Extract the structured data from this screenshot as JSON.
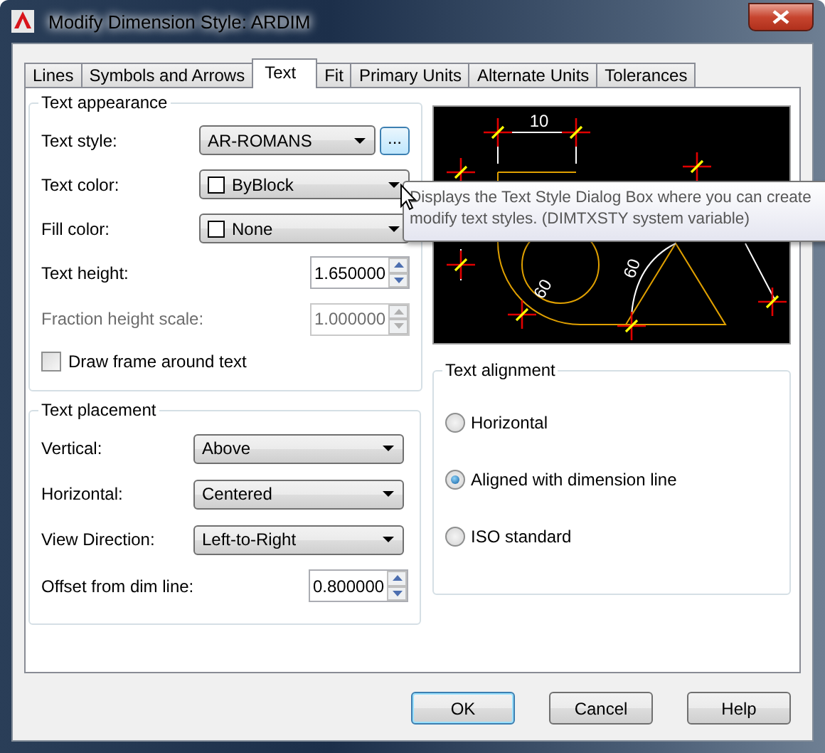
{
  "window": {
    "title": "Modify Dimension Style: ARDIM"
  },
  "tabs": [
    {
      "label": "Lines",
      "selected": false
    },
    {
      "label": "Symbols and Arrows",
      "selected": false
    },
    {
      "label": "Text",
      "selected": true
    },
    {
      "label": "Fit",
      "selected": false
    },
    {
      "label": "Primary Units",
      "selected": false
    },
    {
      "label": "Alternate Units",
      "selected": false
    },
    {
      "label": "Tolerances",
      "selected": false
    }
  ],
  "text_appearance": {
    "title": "Text appearance",
    "fields": [
      {
        "kind": "combo",
        "label": "Text style:",
        "value": "AR-ROMANS",
        "browse_button": "..."
      },
      {
        "kind": "color",
        "label": "Text color:",
        "value": "ByBlock"
      },
      {
        "kind": "color",
        "label": "Fill color:",
        "value": "None"
      },
      {
        "kind": "spinner",
        "label": "Text height:",
        "value": "1.650000",
        "disabled": false
      },
      {
        "kind": "spinner",
        "label": "Fraction height scale:",
        "value": "1.000000",
        "disabled": true
      }
    ],
    "checkbox": {
      "label": "Draw frame around text",
      "checked": false
    }
  },
  "text_placement": {
    "title": "Text placement",
    "fields": [
      {
        "kind": "combo",
        "label": "Vertical:",
        "value": "Above"
      },
      {
        "kind": "combo",
        "label": "Horizontal:",
        "value": "Centered"
      },
      {
        "kind": "combo",
        "label": "View Direction:",
        "value": "Left-to-Right"
      },
      {
        "kind": "spinner",
        "label": "Offset from dim line:",
        "value": "0.800000",
        "disabled": false
      }
    ]
  },
  "preview": {
    "labels": [
      "10",
      "60",
      "60"
    ]
  },
  "text_alignment": {
    "title": "Text alignment",
    "options": [
      {
        "label": "Horizontal",
        "selected": false
      },
      {
        "label": "Aligned with dimension line",
        "selected": true
      },
      {
        "label": "ISO standard",
        "selected": false
      }
    ]
  },
  "tooltip": {
    "lines": [
      "Displays the Text Style Dialog Box where you can create",
      "modify text styles. (DIMTXSTY system variable)"
    ]
  },
  "buttons": [
    {
      "label": "OK",
      "default": true
    },
    {
      "label": "Cancel",
      "default": false
    },
    {
      "label": "Help",
      "default": false
    }
  ]
}
